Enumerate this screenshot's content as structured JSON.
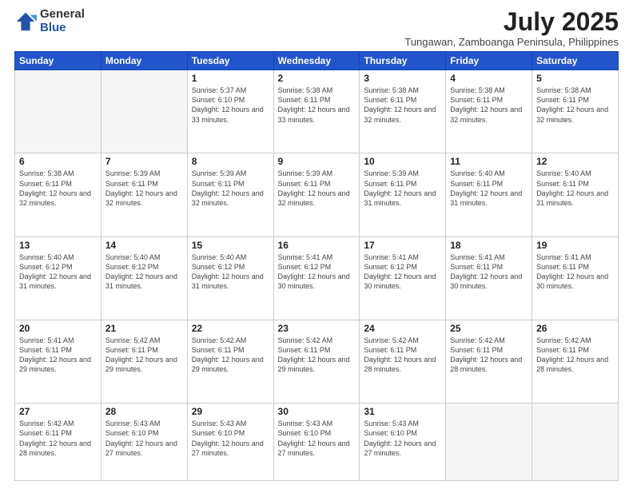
{
  "logo": {
    "general": "General",
    "blue": "Blue"
  },
  "title": "July 2025",
  "subtitle": "Tungawan, Zamboanga Peninsula, Philippines",
  "days_of_week": [
    "Sunday",
    "Monday",
    "Tuesday",
    "Wednesday",
    "Thursday",
    "Friday",
    "Saturday"
  ],
  "weeks": [
    [
      {
        "day": "",
        "info": ""
      },
      {
        "day": "",
        "info": ""
      },
      {
        "day": "1",
        "info": "Sunrise: 5:37 AM\nSunset: 6:10 PM\nDaylight: 12 hours and 33 minutes."
      },
      {
        "day": "2",
        "info": "Sunrise: 5:38 AM\nSunset: 6:11 PM\nDaylight: 12 hours and 33 minutes."
      },
      {
        "day": "3",
        "info": "Sunrise: 5:38 AM\nSunset: 6:11 PM\nDaylight: 12 hours and 32 minutes."
      },
      {
        "day": "4",
        "info": "Sunrise: 5:38 AM\nSunset: 6:11 PM\nDaylight: 12 hours and 32 minutes."
      },
      {
        "day": "5",
        "info": "Sunrise: 5:38 AM\nSunset: 6:11 PM\nDaylight: 12 hours and 32 minutes."
      }
    ],
    [
      {
        "day": "6",
        "info": "Sunrise: 5:38 AM\nSunset: 6:11 PM\nDaylight: 12 hours and 32 minutes."
      },
      {
        "day": "7",
        "info": "Sunrise: 5:39 AM\nSunset: 6:11 PM\nDaylight: 12 hours and 32 minutes."
      },
      {
        "day": "8",
        "info": "Sunrise: 5:39 AM\nSunset: 6:11 PM\nDaylight: 12 hours and 32 minutes."
      },
      {
        "day": "9",
        "info": "Sunrise: 5:39 AM\nSunset: 6:11 PM\nDaylight: 12 hours and 32 minutes."
      },
      {
        "day": "10",
        "info": "Sunrise: 5:39 AM\nSunset: 6:11 PM\nDaylight: 12 hours and 31 minutes."
      },
      {
        "day": "11",
        "info": "Sunrise: 5:40 AM\nSunset: 6:11 PM\nDaylight: 12 hours and 31 minutes."
      },
      {
        "day": "12",
        "info": "Sunrise: 5:40 AM\nSunset: 6:11 PM\nDaylight: 12 hours and 31 minutes."
      }
    ],
    [
      {
        "day": "13",
        "info": "Sunrise: 5:40 AM\nSunset: 6:12 PM\nDaylight: 12 hours and 31 minutes."
      },
      {
        "day": "14",
        "info": "Sunrise: 5:40 AM\nSunset: 6:12 PM\nDaylight: 12 hours and 31 minutes."
      },
      {
        "day": "15",
        "info": "Sunrise: 5:40 AM\nSunset: 6:12 PM\nDaylight: 12 hours and 31 minutes."
      },
      {
        "day": "16",
        "info": "Sunrise: 5:41 AM\nSunset: 6:12 PM\nDaylight: 12 hours and 30 minutes."
      },
      {
        "day": "17",
        "info": "Sunrise: 5:41 AM\nSunset: 6:12 PM\nDaylight: 12 hours and 30 minutes."
      },
      {
        "day": "18",
        "info": "Sunrise: 5:41 AM\nSunset: 6:11 PM\nDaylight: 12 hours and 30 minutes."
      },
      {
        "day": "19",
        "info": "Sunrise: 5:41 AM\nSunset: 6:11 PM\nDaylight: 12 hours and 30 minutes."
      }
    ],
    [
      {
        "day": "20",
        "info": "Sunrise: 5:41 AM\nSunset: 6:11 PM\nDaylight: 12 hours and 29 minutes."
      },
      {
        "day": "21",
        "info": "Sunrise: 5:42 AM\nSunset: 6:11 PM\nDaylight: 12 hours and 29 minutes."
      },
      {
        "day": "22",
        "info": "Sunrise: 5:42 AM\nSunset: 6:11 PM\nDaylight: 12 hours and 29 minutes."
      },
      {
        "day": "23",
        "info": "Sunrise: 5:42 AM\nSunset: 6:11 PM\nDaylight: 12 hours and 29 minutes."
      },
      {
        "day": "24",
        "info": "Sunrise: 5:42 AM\nSunset: 6:11 PM\nDaylight: 12 hours and 28 minutes."
      },
      {
        "day": "25",
        "info": "Sunrise: 5:42 AM\nSunset: 6:11 PM\nDaylight: 12 hours and 28 minutes."
      },
      {
        "day": "26",
        "info": "Sunrise: 5:42 AM\nSunset: 6:11 PM\nDaylight: 12 hours and 28 minutes."
      }
    ],
    [
      {
        "day": "27",
        "info": "Sunrise: 5:42 AM\nSunset: 6:11 PM\nDaylight: 12 hours and 28 minutes."
      },
      {
        "day": "28",
        "info": "Sunrise: 5:43 AM\nSunset: 6:10 PM\nDaylight: 12 hours and 27 minutes."
      },
      {
        "day": "29",
        "info": "Sunrise: 5:43 AM\nSunset: 6:10 PM\nDaylight: 12 hours and 27 minutes."
      },
      {
        "day": "30",
        "info": "Sunrise: 5:43 AM\nSunset: 6:10 PM\nDaylight: 12 hours and 27 minutes."
      },
      {
        "day": "31",
        "info": "Sunrise: 5:43 AM\nSunset: 6:10 PM\nDaylight: 12 hours and 27 minutes."
      },
      {
        "day": "",
        "info": ""
      },
      {
        "day": "",
        "info": ""
      }
    ]
  ]
}
